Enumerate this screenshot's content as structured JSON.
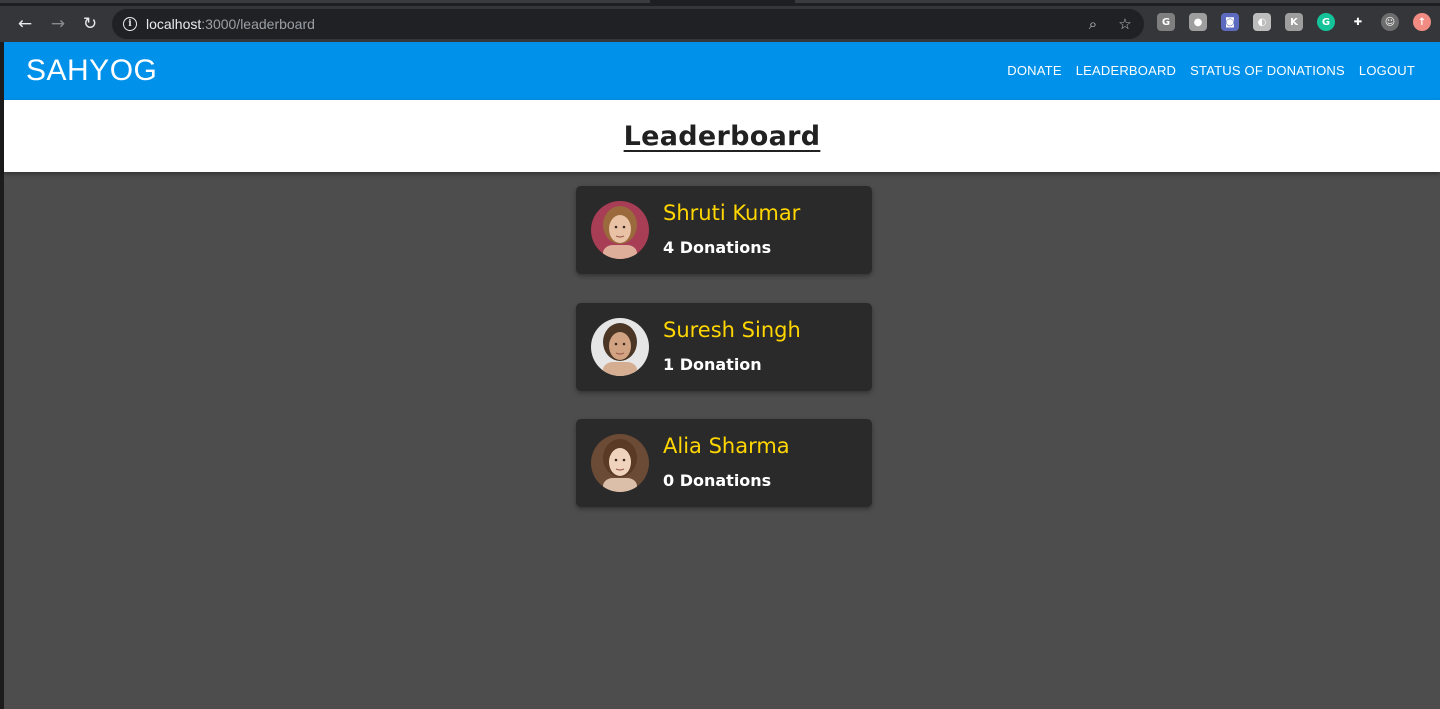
{
  "browser": {
    "url_host": "localhost",
    "url_rest": ":3000/leaderboard",
    "back_icon": "arrow-left-icon",
    "forward_icon": "arrow-right-icon",
    "reload_icon": "reload-icon",
    "extensions": [
      {
        "name": "g-extension-icon",
        "glyph": "G",
        "color": "#7f7f7f"
      },
      {
        "name": "circle-extension-icon",
        "glyph": "●",
        "color": "#9e9e9e"
      },
      {
        "name": "camera-extension-icon",
        "glyph": "◙",
        "color": "#5c6bc0"
      },
      {
        "name": "c-extension-icon",
        "glyph": "◐",
        "color": "#bdbdbd"
      },
      {
        "name": "k-extension-icon",
        "glyph": "K",
        "color": "#9e9e9e"
      },
      {
        "name": "grammarly-extension-icon",
        "glyph": "G",
        "color": "#15c39a"
      },
      {
        "name": "puzzle-extensions-icon",
        "glyph": "✚",
        "color": "#35363a"
      },
      {
        "name": "profile-avatar-icon",
        "glyph": "☺",
        "color": "#6d6d6d"
      },
      {
        "name": "update-icon",
        "glyph": "↑",
        "color": "#f28b82"
      }
    ]
  },
  "navbar": {
    "brand": "SAHYOG",
    "links": [
      "DONATE",
      "LEADERBOARD",
      "STATUS OF DONATIONS",
      "LOGOUT"
    ]
  },
  "page": {
    "title": "Leaderboard"
  },
  "leaderboard": [
    {
      "name": "Shruti Kumar",
      "donations": "4 Donations",
      "avatar_bg": "#a83d56",
      "skin": "#e9c2a6",
      "hair": "#9a6a3c"
    },
    {
      "name": "Suresh Singh",
      "donations": "1 Donation",
      "avatar_bg": "#e6e6e6",
      "skin": "#d1a382",
      "hair": "#4b3626"
    },
    {
      "name": "Alia Sharma",
      "donations": "0 Donations",
      "avatar_bg": "#6b4a36",
      "skin": "#f0d3bd",
      "hair": "#5a3a24"
    }
  ],
  "colors": {
    "navbar": "#0091ea",
    "background": "#4d4d4d",
    "card": "#2a2a2a",
    "name": "#ffd600"
  }
}
